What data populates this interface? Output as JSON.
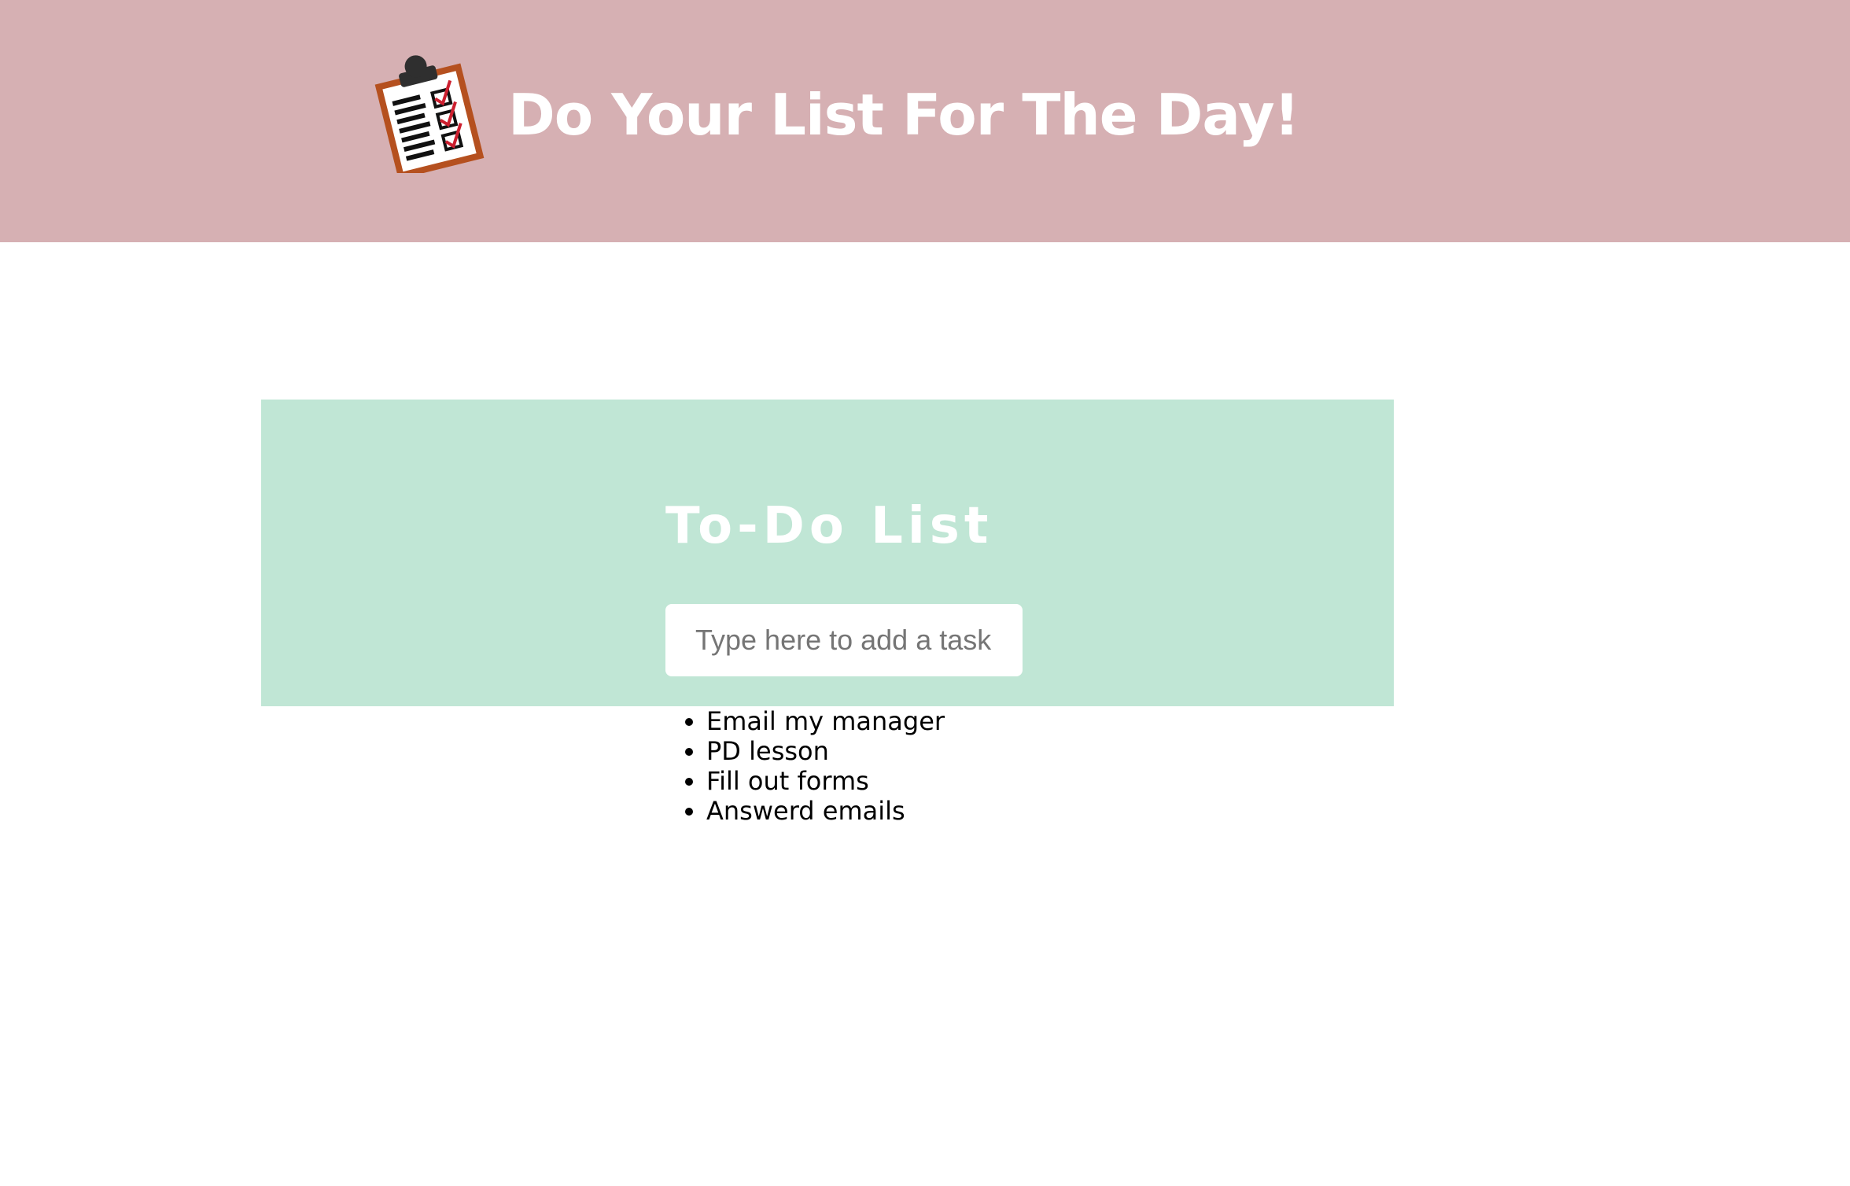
{
  "header": {
    "logo_icon": "clipboard-checklist-icon",
    "title": "Do Your List For The Day!"
  },
  "todo": {
    "title": "To-Do List",
    "input": {
      "placeholder": "Type here to add a task",
      "value": ""
    },
    "tasks": [
      "Email my manager",
      "PD lesson",
      "Fill out forms",
      "Answerd emails"
    ]
  },
  "colors": {
    "header_bg": "#d6b0b3",
    "panel_bg": "#c0e6d5",
    "heading_text": "#ffffff"
  }
}
